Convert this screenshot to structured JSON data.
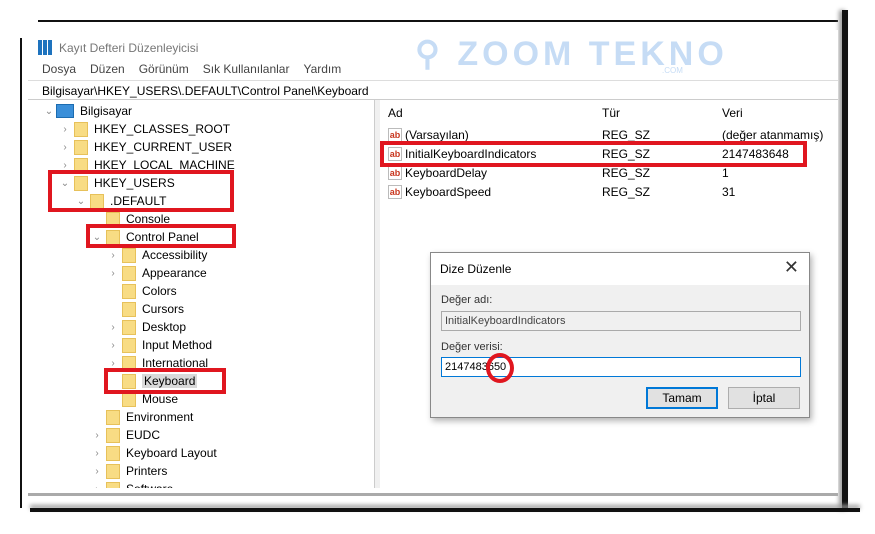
{
  "window": {
    "title": "Kayıt Defteri Düzenleyicisi",
    "address": "Bilgisayar\\HKEY_USERS\\.DEFAULT\\Control Panel\\Keyboard"
  },
  "menu": [
    "Dosya",
    "Düzen",
    "Görünüm",
    "Sık Kullanılanlar",
    "Yardım"
  ],
  "watermark": {
    "text": "ZOOM TEKNO",
    "sub": ".COM"
  },
  "tree": [
    {
      "label": "Bilgisayar",
      "level": 0,
      "state": "expanded",
      "icon": "computer-icon"
    },
    {
      "label": "HKEY_CLASSES_ROOT",
      "level": 1,
      "state": "collapsed"
    },
    {
      "label": "HKEY_CURRENT_USER",
      "level": 1,
      "state": "collapsed"
    },
    {
      "label": "HKEY_LOCAL_MACHINE",
      "level": 1,
      "state": "collapsed"
    },
    {
      "label": "HKEY_USERS",
      "level": 1,
      "state": "expanded"
    },
    {
      "label": ".DEFAULT",
      "level": 2,
      "state": "expanded"
    },
    {
      "label": "Console",
      "level": 3,
      "state": "none"
    },
    {
      "label": "Control Panel",
      "level": 3,
      "state": "expanded"
    },
    {
      "label": "Accessibility",
      "level": 4,
      "state": "collapsed"
    },
    {
      "label": "Appearance",
      "level": 4,
      "state": "collapsed"
    },
    {
      "label": "Colors",
      "level": 4,
      "state": "none"
    },
    {
      "label": "Cursors",
      "level": 4,
      "state": "none"
    },
    {
      "label": "Desktop",
      "level": 4,
      "state": "collapsed"
    },
    {
      "label": "Input Method",
      "level": 4,
      "state": "collapsed"
    },
    {
      "label": "International",
      "level": 4,
      "state": "collapsed"
    },
    {
      "label": "Keyboard",
      "level": 4,
      "state": "none",
      "selected": true
    },
    {
      "label": "Mouse",
      "level": 4,
      "state": "none"
    },
    {
      "label": "Environment",
      "level": 3,
      "state": "none"
    },
    {
      "label": "EUDC",
      "level": 3,
      "state": "collapsed"
    },
    {
      "label": "Keyboard Layout",
      "level": 3,
      "state": "collapsed"
    },
    {
      "label": "Printers",
      "level": 3,
      "state": "collapsed"
    },
    {
      "label": "Software",
      "level": 3,
      "state": "collapsed"
    }
  ],
  "list": {
    "headers": [
      "Ad",
      "Tür",
      "Veri"
    ],
    "rows": [
      [
        "(Varsayılan)",
        "REG_SZ",
        "(değer atanmamış)"
      ],
      [
        "InitialKeyboardIndicators",
        "REG_SZ",
        "2147483648"
      ],
      [
        "KeyboardDelay",
        "REG_SZ",
        "1"
      ],
      [
        "KeyboardSpeed",
        "REG_SZ",
        "31"
      ]
    ]
  },
  "dialog": {
    "title": "Dize Düzenle",
    "name_label": "Değer adı:",
    "name_value": "InitialKeyboardIndicators",
    "data_label": "Değer verisi:",
    "data_value": "2147483650",
    "ok": "Tamam",
    "cancel": "İptal"
  },
  "colors": {
    "highlight": "#e0161f",
    "accent": "#0078d7"
  }
}
